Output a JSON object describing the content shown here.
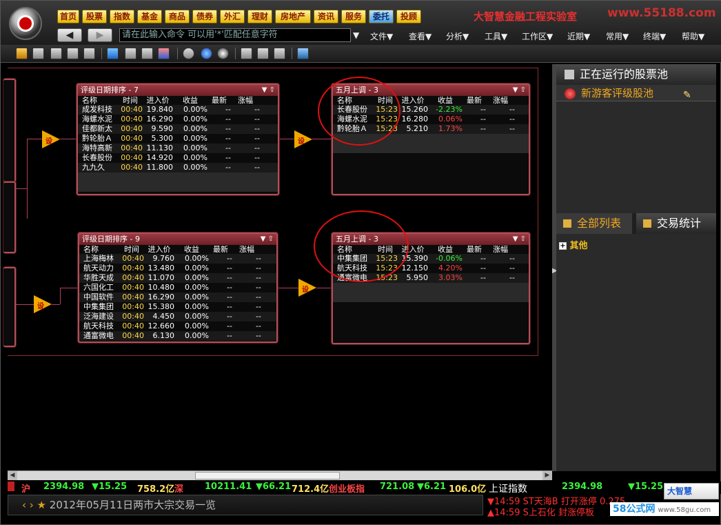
{
  "nav": {
    "buttons": [
      "首页",
      "股票",
      "指数",
      "基金",
      "商品",
      "债券",
      "外汇",
      "理财",
      "房地产",
      "资讯",
      "服务",
      "委托",
      "投顾"
    ],
    "active_index": 11,
    "brand": "大智慧金融工程实验室",
    "site": "www.55188.com"
  },
  "command": {
    "placeholder": "请在此输入命令    可以用'*'匹配任意字符"
  },
  "menus": [
    "文件▼",
    "查看▼",
    "分析▼",
    "工具▼",
    "工作区▼",
    "近期▼",
    "常用▼",
    "终端▼",
    "帮助▼"
  ],
  "diamond_label": "设",
  "panels": {
    "top_left": {
      "title": "评级日期排序 - 7",
      "columns": [
        "名称",
        "时间",
        "进入价",
        "收益",
        "最新",
        "涨幅"
      ],
      "rows": [
        {
          "name": "成发科技",
          "time": "00:40",
          "price": "19.840",
          "gain": "0.00%",
          "latest": "--",
          "chg": "--",
          "sign": "zero"
        },
        {
          "name": "海螺水泥",
          "time": "00:40",
          "price": "16.290",
          "gain": "0.00%",
          "latest": "--",
          "chg": "--",
          "sign": "zero"
        },
        {
          "name": "佳都新太",
          "time": "00:40",
          "price": "9.590",
          "gain": "0.00%",
          "latest": "--",
          "chg": "--",
          "sign": "zero"
        },
        {
          "name": "黔轮胎Ａ",
          "time": "00:40",
          "price": "5.300",
          "gain": "0.00%",
          "latest": "--",
          "chg": "--",
          "sign": "zero"
        },
        {
          "name": "海特高新",
          "time": "00:40",
          "price": "11.130",
          "gain": "0.00%",
          "latest": "--",
          "chg": "--",
          "sign": "zero"
        },
        {
          "name": "长春股份",
          "time": "00:40",
          "price": "14.920",
          "gain": "0.00%",
          "latest": "--",
          "chg": "--",
          "sign": "zero"
        },
        {
          "name": "九九久",
          "time": "00:40",
          "price": "11.800",
          "gain": "0.00%",
          "latest": "--",
          "chg": "--",
          "sign": "zero"
        }
      ]
    },
    "top_right": {
      "title": "五月上调 - 3",
      "columns": [
        "名称",
        "时间",
        "进入价",
        "收益",
        "最新",
        "涨幅"
      ],
      "rows": [
        {
          "name": "长春股份",
          "time": "15:23",
          "price": "15.260",
          "gain": "-2.23%",
          "latest": "--",
          "chg": "--",
          "sign": "neg"
        },
        {
          "name": "海螺水泥",
          "time": "15:23",
          "price": "16.280",
          "gain": "0.06%",
          "latest": "--",
          "chg": "--",
          "sign": "pos"
        },
        {
          "name": "黔轮胎Ａ",
          "time": "15:23",
          "price": "5.210",
          "gain": "1.73%",
          "latest": "--",
          "chg": "--",
          "sign": "pos"
        }
      ]
    },
    "bottom_left": {
      "title": "评级日期排序 - 9",
      "columns": [
        "名称",
        "时间",
        "进入价",
        "收益",
        "最新",
        "涨幅"
      ],
      "rows": [
        {
          "name": "上海梅林",
          "time": "00:40",
          "price": "9.760",
          "gain": "0.00%",
          "latest": "--",
          "chg": "--",
          "sign": "zero"
        },
        {
          "name": "航天动力",
          "time": "00:40",
          "price": "13.480",
          "gain": "0.00%",
          "latest": "--",
          "chg": "--",
          "sign": "zero"
        },
        {
          "name": "华胜天成",
          "time": "00:40",
          "price": "11.070",
          "gain": "0.00%",
          "latest": "--",
          "chg": "--",
          "sign": "zero"
        },
        {
          "name": "六国化工",
          "time": "00:40",
          "price": "10.480",
          "gain": "0.00%",
          "latest": "--",
          "chg": "--",
          "sign": "zero"
        },
        {
          "name": "中国软件",
          "time": "00:40",
          "price": "16.290",
          "gain": "0.00%",
          "latest": "--",
          "chg": "--",
          "sign": "zero"
        },
        {
          "name": "中集集团",
          "time": "00:40",
          "price": "15.380",
          "gain": "0.00%",
          "latest": "--",
          "chg": "--",
          "sign": "zero"
        },
        {
          "name": "泛海建设",
          "time": "00:40",
          "price": "4.450",
          "gain": "0.00%",
          "latest": "--",
          "chg": "--",
          "sign": "zero"
        },
        {
          "name": "航天科技",
          "time": "00:40",
          "price": "12.660",
          "gain": "0.00%",
          "latest": "--",
          "chg": "--",
          "sign": "zero"
        },
        {
          "name": "通富微电",
          "time": "00:40",
          "price": "6.130",
          "gain": "0.00%",
          "latest": "--",
          "chg": "--",
          "sign": "zero"
        }
      ]
    },
    "bottom_right": {
      "title": "五月上调 - 3",
      "columns": [
        "名称",
        "时间",
        "进入价",
        "收益",
        "最新",
        "涨幅"
      ],
      "rows": [
        {
          "name": "中集集团",
          "time": "15:23",
          "price": "15.390",
          "gain": "-0.06%",
          "latest": "--",
          "chg": "--",
          "sign": "neg"
        },
        {
          "name": "航天科技",
          "time": "15:23",
          "price": "12.150",
          "gain": "4.20%",
          "latest": "--",
          "chg": "--",
          "sign": "pos"
        },
        {
          "name": "通富微电",
          "time": "15:23",
          "price": "5.950",
          "gain": "3.03%",
          "latest": "--",
          "chg": "--",
          "sign": "pos"
        }
      ]
    }
  },
  "right_panel": {
    "running_title": "正在运行的股票池",
    "pool_name": "新游客评级股池",
    "tab_all": "全部列表",
    "tab_stats": "交易统计",
    "tree_other": "其他"
  },
  "ticker": {
    "sh_label": "沪",
    "sh_index": "2394.98",
    "sh_change": "▼15.25",
    "sh_amount": "758.2亿",
    "sz_label": "深",
    "sz_index": "10211.41",
    "sz_change": "▼66.21",
    "sz_amount": "712.4亿",
    "cy_label": "创业板指",
    "cy_index": "721.08",
    "cy_change": "▼6.21",
    "cy_amount": "106.0亿"
  },
  "news": {
    "text": "2012年05月11日两市大宗交易一览"
  },
  "bottom_right": {
    "index_name": "上证指数",
    "index_value": "2394.98",
    "index_change": "▼15.25",
    "alert1": "▼14:59 ST天海B  打开涨停 0.275",
    "alert2": "▲14:59 S上石化  封涨停板",
    "logo": "大智慧",
    "watermark": "58公式网",
    "watermark_url": "www.58gu.com"
  },
  "colors": {
    "accent_red": "#e01010",
    "panel_border": "#b05058",
    "gain_pos": "#ff4646",
    "gain_neg": "#3cf03c",
    "time": "#ffd84a"
  }
}
